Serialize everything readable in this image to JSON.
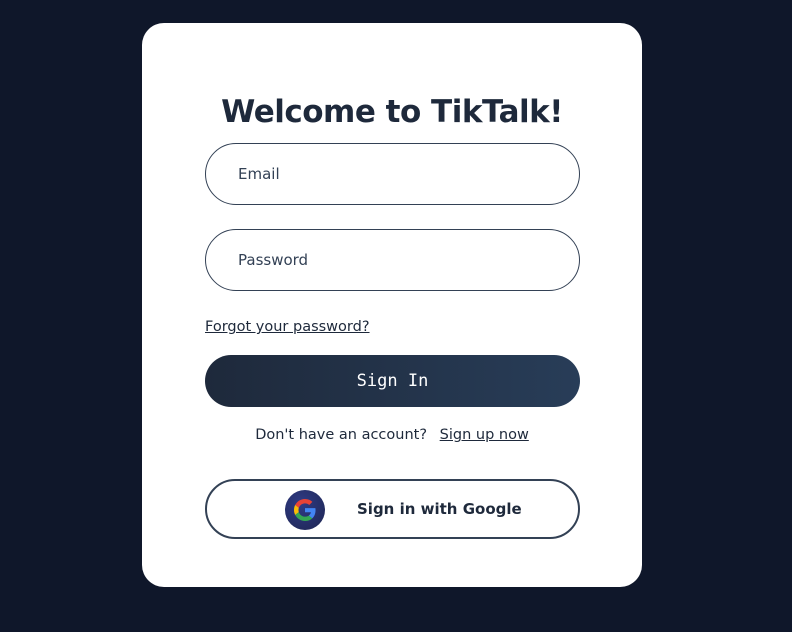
{
  "login": {
    "title": "Welcome to TikTalk!",
    "email_placeholder": "Email",
    "password_placeholder": "Password",
    "forgot_password": "Forgot your password?",
    "sign_in_label": "Sign In",
    "no_account_text": "Don't have an account?",
    "sign_up_link": "Sign up now",
    "google_label": "Sign in with Google",
    "google_icon": "google-icon"
  },
  "colors": {
    "background": "#0f172a",
    "card": "#ffffff",
    "text": "#1e293b",
    "accent": "#1e293b"
  }
}
